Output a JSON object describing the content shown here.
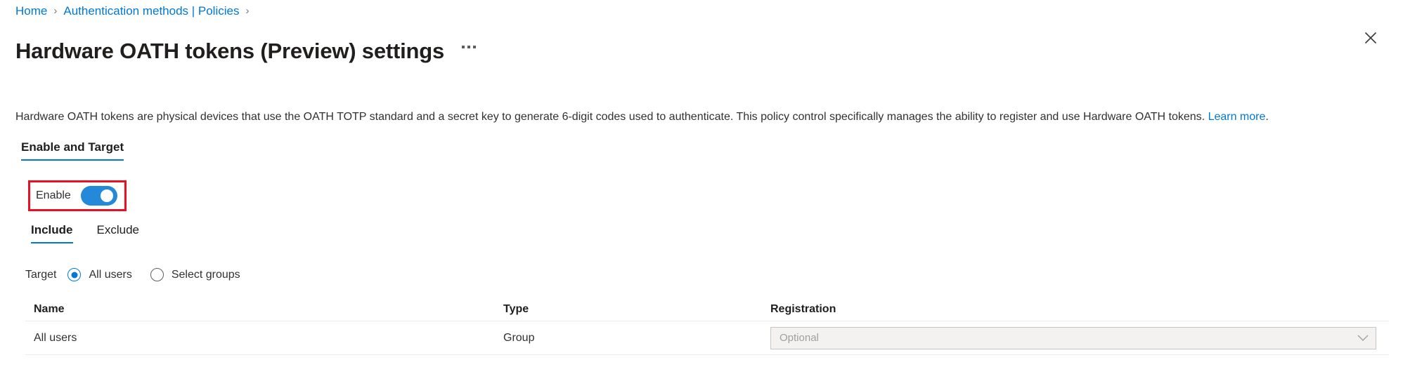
{
  "breadcrumb": {
    "items": [
      {
        "label": "Home"
      },
      {
        "label": "Authentication methods | Policies"
      }
    ],
    "separator": "›"
  },
  "header": {
    "title": "Hardware OATH tokens (Preview) settings",
    "more_label": "• • •",
    "close_icon": "close-icon"
  },
  "description": {
    "text": "Hardware OATH tokens are physical devices that use the OATH TOTP standard and a secret key to generate 6-digit codes used to authenticate. This policy control specifically manages the ability to register and use Hardware OATH tokens. ",
    "link_label": "Learn more",
    "link_suffix": "."
  },
  "pivot": {
    "tabs": [
      {
        "label": "Enable and Target",
        "active": true
      }
    ]
  },
  "enable": {
    "label": "Enable",
    "state": "on",
    "highlight_color": "#e81123",
    "toggle_color": "#2489d8"
  },
  "sub_pivot": {
    "tabs": [
      {
        "label": "Include",
        "active": true
      },
      {
        "label": "Exclude",
        "active": false
      }
    ]
  },
  "target": {
    "label": "Target",
    "options": [
      {
        "label": "All users",
        "selected": true
      },
      {
        "label": "Select groups",
        "selected": false
      }
    ]
  },
  "table": {
    "columns": [
      {
        "key": "name",
        "label": "Name"
      },
      {
        "key": "type",
        "label": "Type"
      },
      {
        "key": "registration",
        "label": "Registration"
      }
    ],
    "rows": [
      {
        "name": "All users",
        "type": "Group",
        "registration": "Optional",
        "registration_disabled": true
      }
    ]
  }
}
